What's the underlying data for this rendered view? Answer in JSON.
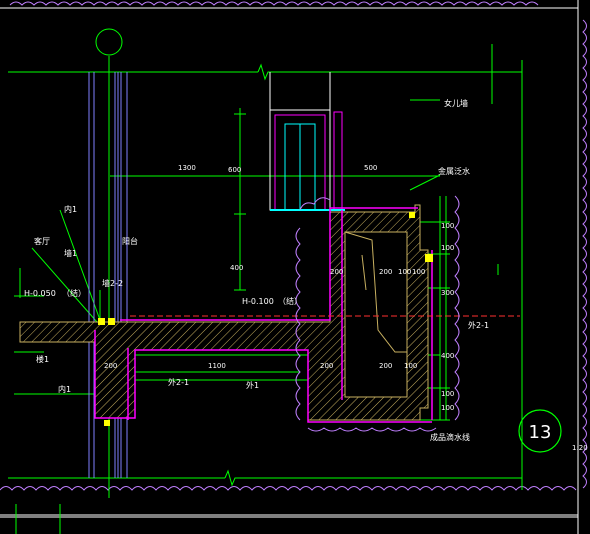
{
  "drawing": {
    "sheet_number": "13",
    "sheet_scale": "1:20",
    "annotations": {
      "parapet_line": "女儿墙",
      "metal_cap": "金属泛水",
      "inner_1": "内1",
      "living_room": "客厅",
      "balcony": "阳台",
      "wall_1": "墙1",
      "wall_2_2": "墙2-2",
      "elev_left": "H-0.050",
      "elev_left_note": "（结）",
      "elev_mid": "H-0.100",
      "elev_mid_note": "（结）",
      "floor_1": "楼1",
      "inner_1_b": "内1",
      "outer_2_1_a": "外2-1",
      "outer_2_1_b": "外2-1",
      "outer_1_b": "外1",
      "waterproof": "成品滴水线"
    },
    "dimensions": {
      "d1300": "1300",
      "d600": "600",
      "d500": "500",
      "d400": "400",
      "d200a": "200",
      "d200b": "200",
      "d100a": "100",
      "d100b": "100",
      "d1100": "1100",
      "d200c": "200",
      "d200d": "200",
      "d200e": "200",
      "d100c": "100",
      "r100a": "100",
      "r300": "300",
      "r400": "400",
      "r100b": "100",
      "r100c": "100",
      "r100d": "100"
    },
    "colors": {
      "background": "#000000",
      "grid": "#00ff00",
      "wall": "#ff00ff",
      "cloud": "#c080ff",
      "frame": "#ffffff",
      "hatch": "#c8b060",
      "axis": "#ff3030",
      "yellow": "#ffff00",
      "cyan": "#00ffff"
    }
  }
}
